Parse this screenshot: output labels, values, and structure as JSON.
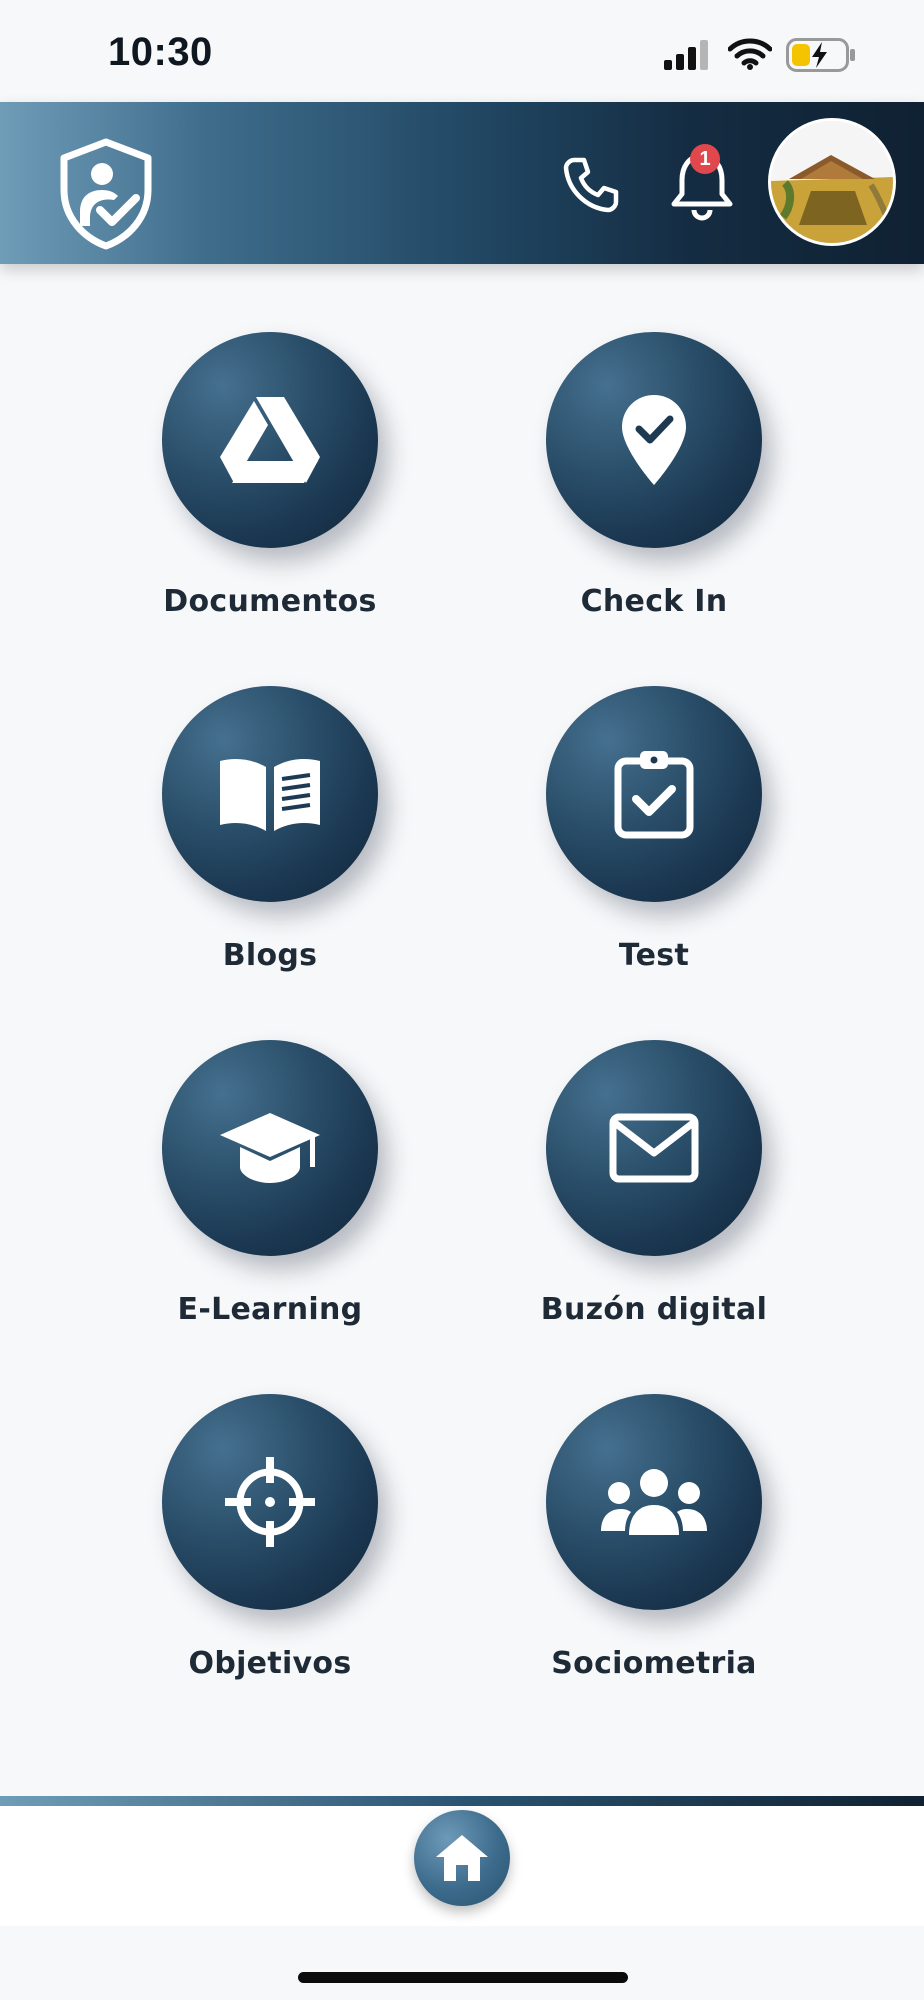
{
  "status_bar": {
    "time": "10:30"
  },
  "header": {
    "notification_count": "1"
  },
  "menu": {
    "items": [
      {
        "label": "Documentos",
        "icon": "drive-icon"
      },
      {
        "label": "Check In",
        "icon": "location-check-icon"
      },
      {
        "label": "Blogs",
        "icon": "open-book-icon"
      },
      {
        "label": "Test",
        "icon": "clipboard-check-icon"
      },
      {
        "label": "E-Learning",
        "icon": "graduation-cap-icon"
      },
      {
        "label": "Buzón digital",
        "icon": "envelope-icon"
      },
      {
        "label": "Objetivos",
        "icon": "crosshair-icon"
      },
      {
        "label": "Sociometria",
        "icon": "users-icon"
      }
    ]
  },
  "colors": {
    "primary_dark": "#13263a",
    "primary": "#2b506b",
    "accent_light": "#6f9db8",
    "badge": "#e0484e"
  },
  "bottom_nav": {
    "icon": "home-icon"
  }
}
